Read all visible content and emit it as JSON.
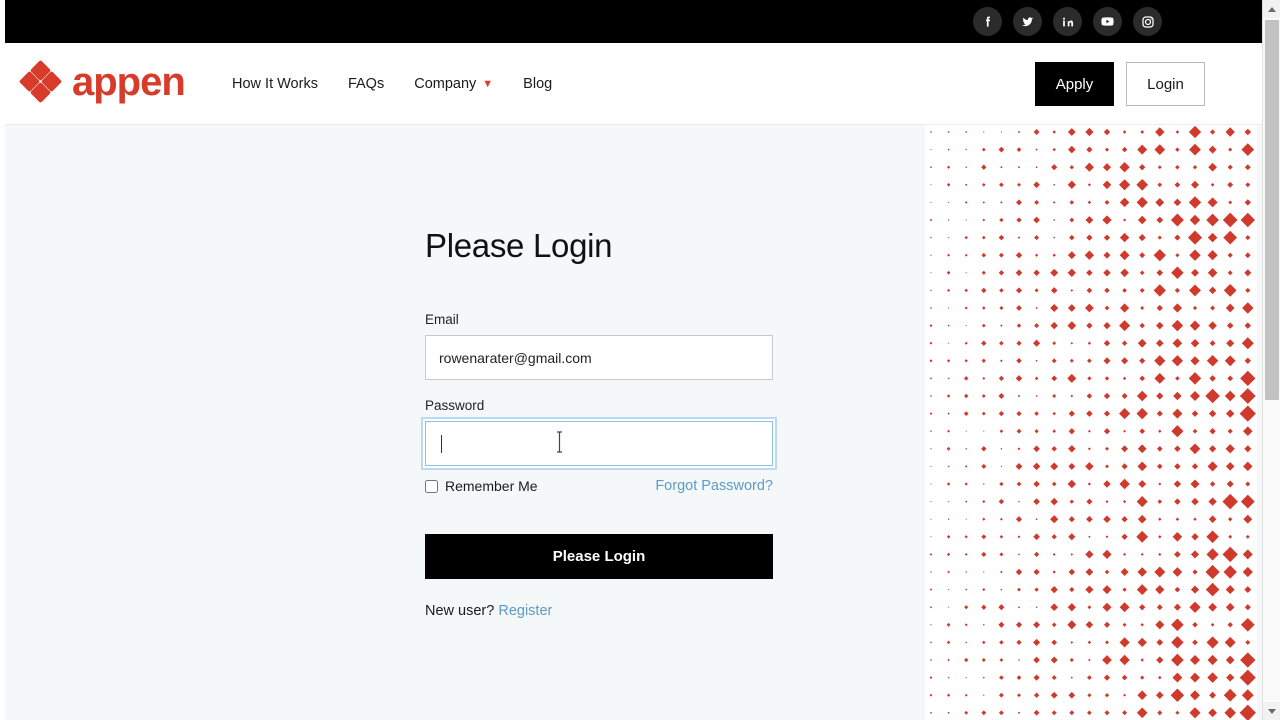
{
  "brand": {
    "name": "appen",
    "logo_color": "#d93b2b",
    "accent_color": "#d93b2b"
  },
  "topbar": {
    "background": "#000000",
    "social": [
      {
        "name": "facebook-icon",
        "label": "Facebook"
      },
      {
        "name": "twitter-icon",
        "label": "Twitter"
      },
      {
        "name": "linkedin-icon",
        "label": "LinkedIn"
      },
      {
        "name": "youtube-icon",
        "label": "YouTube"
      },
      {
        "name": "instagram-icon",
        "label": "Instagram"
      }
    ]
  },
  "nav": {
    "items": [
      {
        "label": "How It Works",
        "has_dropdown": false
      },
      {
        "label": "FAQs",
        "has_dropdown": false
      },
      {
        "label": "Company",
        "has_dropdown": true
      },
      {
        "label": "Blog",
        "has_dropdown": false
      }
    ],
    "apply_label": "Apply",
    "login_label": "Login"
  },
  "form": {
    "title": "Please Login",
    "email_label": "Email",
    "email_value": "rowenarater@gmail.com",
    "email_placeholder": "",
    "password_label": "Password",
    "password_value": "",
    "password_placeholder": "",
    "remember_label": "Remember Me",
    "remember_checked": false,
    "forgot_label": "Forgot Password?",
    "submit_label": "Please Login",
    "newuser_text": "New user? ",
    "register_label": "Register",
    "link_color": "#5d9bc6",
    "focus_ring_color": "#bcd9ef"
  },
  "decor": {
    "pattern_name": "diamond-dot-grid",
    "diamond_color": "#cf3a2c",
    "background": "#ffffff"
  },
  "page": {
    "background": "#f4f8f8"
  }
}
